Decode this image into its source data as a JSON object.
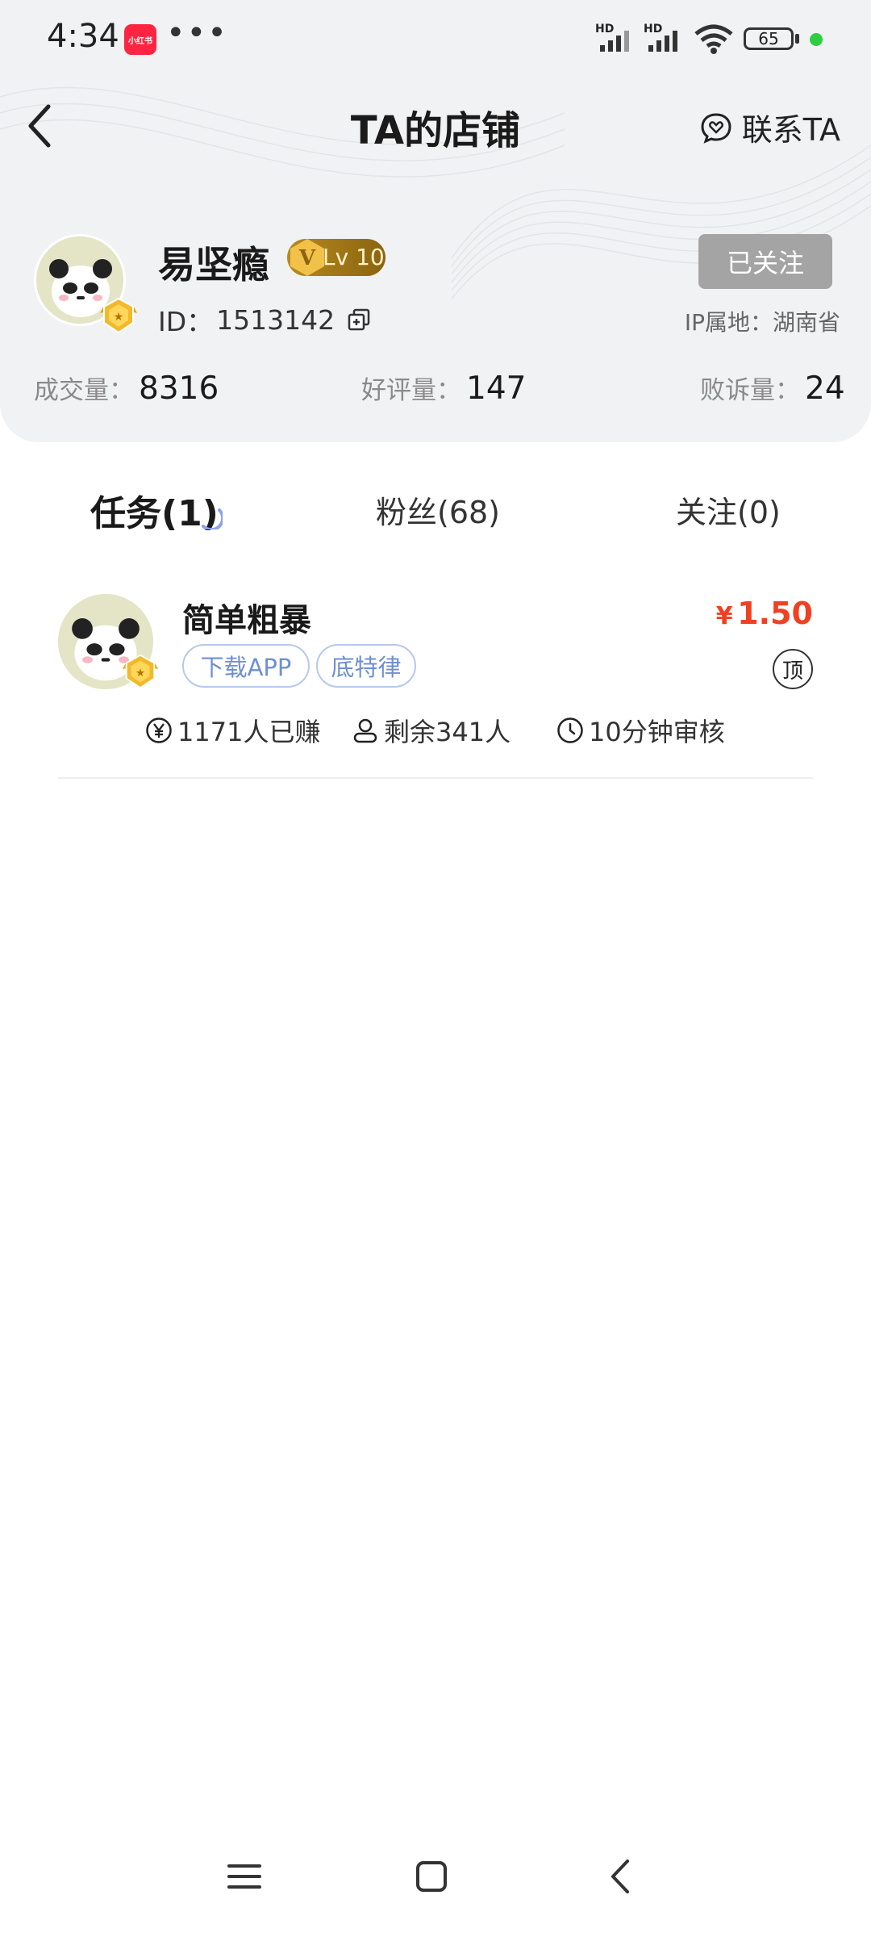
{
  "status_bar": {
    "time": "4:34",
    "app_badge": "小红书",
    "more": "•••",
    "hd1": "HD",
    "hd2": "HD",
    "battery": "65"
  },
  "nav": {
    "title": "TA的店铺",
    "contact_label": "联系TA"
  },
  "profile": {
    "username": "易坚瘾",
    "vip_level": "Lv 10",
    "id_label": "ID：",
    "id_value": "1513142",
    "follow_label": "已关注",
    "ip_label": "IP属地：湖南省"
  },
  "stats": [
    {
      "label": "成交量：",
      "value": "8316"
    },
    {
      "label": "好评量：",
      "value": "147"
    },
    {
      "label": "败诉量：",
      "value": "24"
    }
  ],
  "tabs": [
    {
      "label": "任务(1)",
      "active": true
    },
    {
      "label": "粉丝(68)",
      "active": false
    },
    {
      "label": "关注(0)",
      "active": false
    }
  ],
  "task": {
    "title": "简单粗暴",
    "tags": [
      "下载APP",
      "底特律"
    ],
    "currency": "¥",
    "price": "1.50",
    "top_badge": "顶",
    "earned": "1171人已赚",
    "remaining": "剩余341人",
    "review_time": "10分钟审核"
  },
  "colors": {
    "price": "#ef4122",
    "tag_text": "#6f8fd0",
    "vip_gold": "#b88a1e",
    "follow_btn": "#a4a4a4"
  }
}
